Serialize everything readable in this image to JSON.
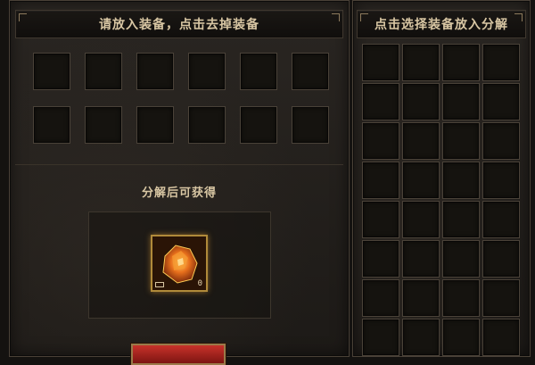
{
  "equip_panel": {
    "header": "请放入装备，点击去掉装备",
    "slot_count": 12
  },
  "result": {
    "title": "分解后可获得",
    "item": {
      "icon": "ore-crystal-icon",
      "count": "0"
    }
  },
  "inventory_panel": {
    "header": "点击选择装备放入分解",
    "slot_count": 32
  },
  "colors": {
    "accent_text": "#d8c6a3",
    "button_red": "#c8322a",
    "item_glow": "#ffb43c"
  }
}
